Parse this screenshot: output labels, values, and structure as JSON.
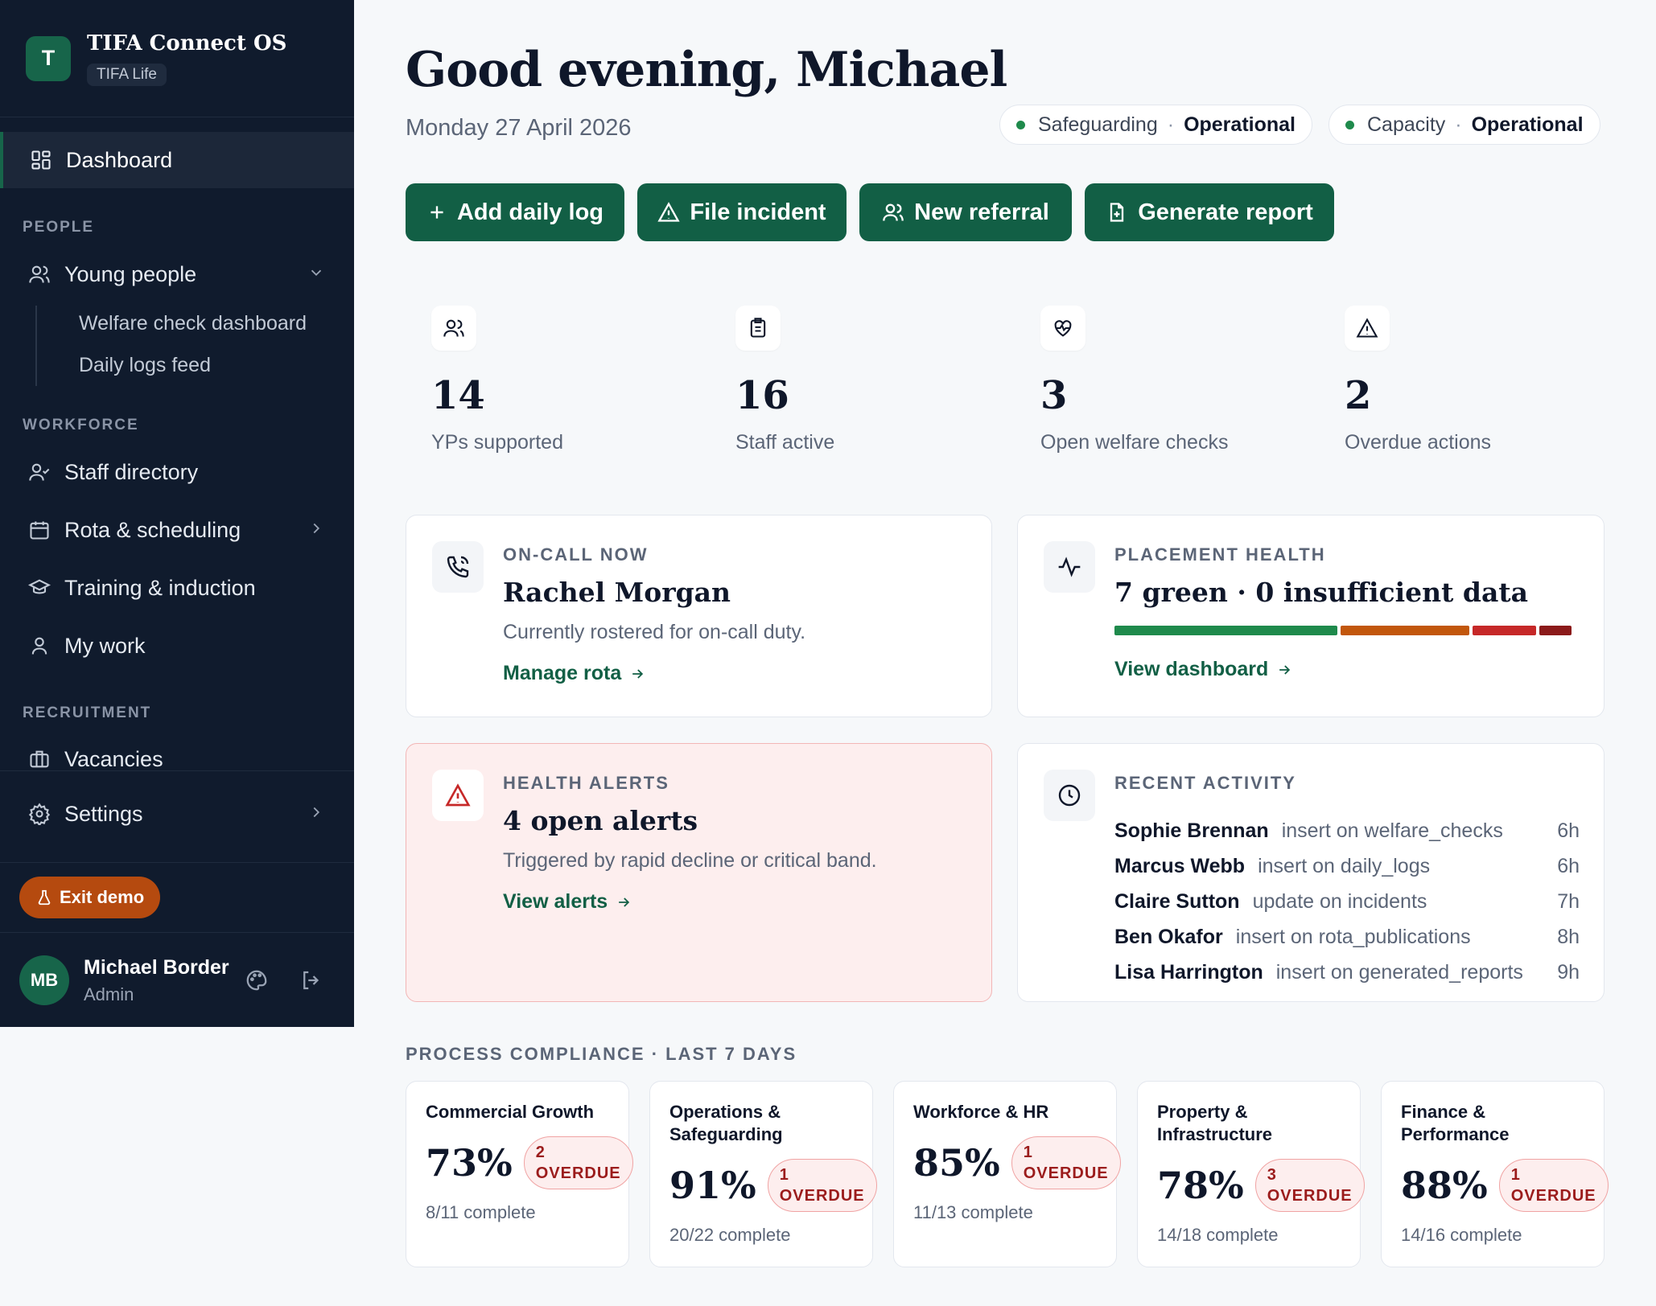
{
  "app": {
    "name": "TIFA Connect OS",
    "org": "TIFA Life",
    "logo_letter": "T"
  },
  "sidebar": {
    "dashboard": "Dashboard",
    "sections": {
      "people": "PEOPLE",
      "workforce": "WORKFORCE",
      "recruitment": "RECRUITMENT"
    },
    "young_people": "Young people",
    "welfare_dashboard": "Welfare check dashboard",
    "daily_logs_feed": "Daily logs feed",
    "staff_directory": "Staff directory",
    "rota": "Rota & scheduling",
    "training": "Training & induction",
    "my_work": "My work",
    "vacancies": "Vacancies",
    "settings": "Settings",
    "exit_demo": "Exit demo",
    "user": {
      "initials": "MB",
      "name": "Michael Border",
      "role": "Admin"
    }
  },
  "header": {
    "greeting": "Good evening, Michael",
    "date": "Monday 27 April 2026",
    "status": [
      {
        "label": "Safeguarding",
        "sep": "·",
        "value": "Operational"
      },
      {
        "label": "Capacity",
        "sep": "·",
        "value": "Operational"
      }
    ]
  },
  "actions": [
    "Add daily log",
    "File incident",
    "New referral",
    "Generate report"
  ],
  "stats": [
    {
      "value": "14",
      "label": "YPs supported"
    },
    {
      "value": "16",
      "label": "Staff active"
    },
    {
      "value": "3",
      "label": "Open welfare checks"
    },
    {
      "value": "2",
      "label": "Overdue actions"
    }
  ],
  "oncall": {
    "eyebrow": "ON-CALL NOW",
    "title": "Rachel Morgan",
    "desc": "Currently rostered for on-call duty.",
    "link": "Manage rota"
  },
  "placement": {
    "eyebrow": "PLACEMENT HEALTH",
    "title": "7 green · 0 insufficient data",
    "link": "View dashboard",
    "bar": [
      {
        "color": "#1f8a4c",
        "share": 0.49
      },
      {
        "color": "#c2570c",
        "share": 0.285
      },
      {
        "color": "#c62828",
        "share": 0.14
      },
      {
        "color": "#8b1a1a",
        "share": 0.07
      }
    ]
  },
  "alerts": {
    "eyebrow": "HEALTH ALERTS",
    "title": "4 open alerts",
    "desc": "Triggered by rapid decline or critical band.",
    "link": "View alerts"
  },
  "activity": {
    "eyebrow": "RECENT ACTIVITY",
    "items": [
      {
        "name": "Sophie Brennan",
        "what": "insert on welfare_checks",
        "time": "6h"
      },
      {
        "name": "Marcus Webb",
        "what": "insert on daily_logs",
        "time": "6h"
      },
      {
        "name": "Claire Sutton",
        "what": "update on incidents",
        "time": "7h"
      },
      {
        "name": "Ben Okafor",
        "what": "insert on rota_publications",
        "time": "8h"
      },
      {
        "name": "Lisa Harrington",
        "what": "insert on generated_reports",
        "time": "9h"
      }
    ]
  },
  "compliance": {
    "label": "PROCESS COMPLIANCE · LAST 7 DAYS",
    "items": [
      {
        "title": "Commercial Growth",
        "pct": "73%",
        "overdue_count": "2",
        "overdue_label": "OVERDUE",
        "sub": "8/11 complete"
      },
      {
        "title": "Operations & Safeguarding",
        "pct": "91%",
        "overdue_count": "1",
        "overdue_label": "OVERDUE",
        "sub": "20/22 complete"
      },
      {
        "title": "Workforce & HR",
        "pct": "85%",
        "overdue_count": "1",
        "overdue_label": "OVERDUE",
        "sub": "11/13 complete"
      },
      {
        "title": "Property & Infrastructure",
        "pct": "78%",
        "overdue_count": "3",
        "overdue_label": "OVERDUE",
        "sub": "14/18 complete"
      },
      {
        "title": "Finance & Performance",
        "pct": "88%",
        "overdue_count": "1",
        "overdue_label": "OVERDUE",
        "sub": "14/16 complete"
      }
    ]
  }
}
